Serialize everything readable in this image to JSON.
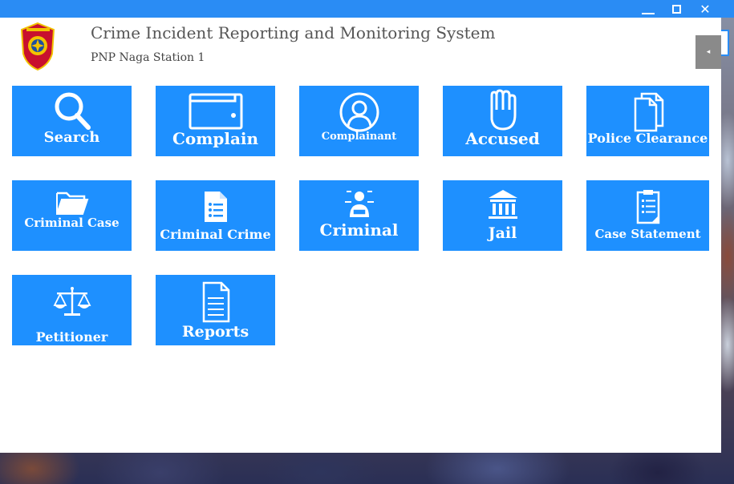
{
  "app": {
    "title": "Crime Incident Reporting and Monitoring System",
    "subtitle": "PNP Naga Station 1"
  },
  "window": {
    "minimize_icon": "minimize-icon",
    "maximize_icon": "maximize-icon",
    "close_label": "✕"
  },
  "sidebar_toggle": {
    "label": "◂"
  },
  "tiles": [
    {
      "label": "Search",
      "icon": "search-icon"
    },
    {
      "label": "Complain",
      "icon": "wallet-icon"
    },
    {
      "label": "Complainant",
      "icon": "user-circle-icon"
    },
    {
      "label": "Accused",
      "icon": "hand-icon"
    },
    {
      "label": "Police Clearance",
      "icon": "documents-icon"
    },
    {
      "label": "Criminal Case",
      "icon": "folder-icon"
    },
    {
      "label": "Criminal Crime",
      "icon": "list-document-icon"
    },
    {
      "label": "Criminal",
      "icon": "criminal-icon"
    },
    {
      "label": "Jail",
      "icon": "jail-building-icon"
    },
    {
      "label": "Case Statement",
      "icon": "clipboard-icon"
    },
    {
      "label": "Petitioner",
      "icon": "scales-icon"
    },
    {
      "label": "Reports",
      "icon": "report-document-icon"
    }
  ],
  "colors": {
    "accent": "#1e90ff",
    "titlebar": "#2a8cf4"
  }
}
